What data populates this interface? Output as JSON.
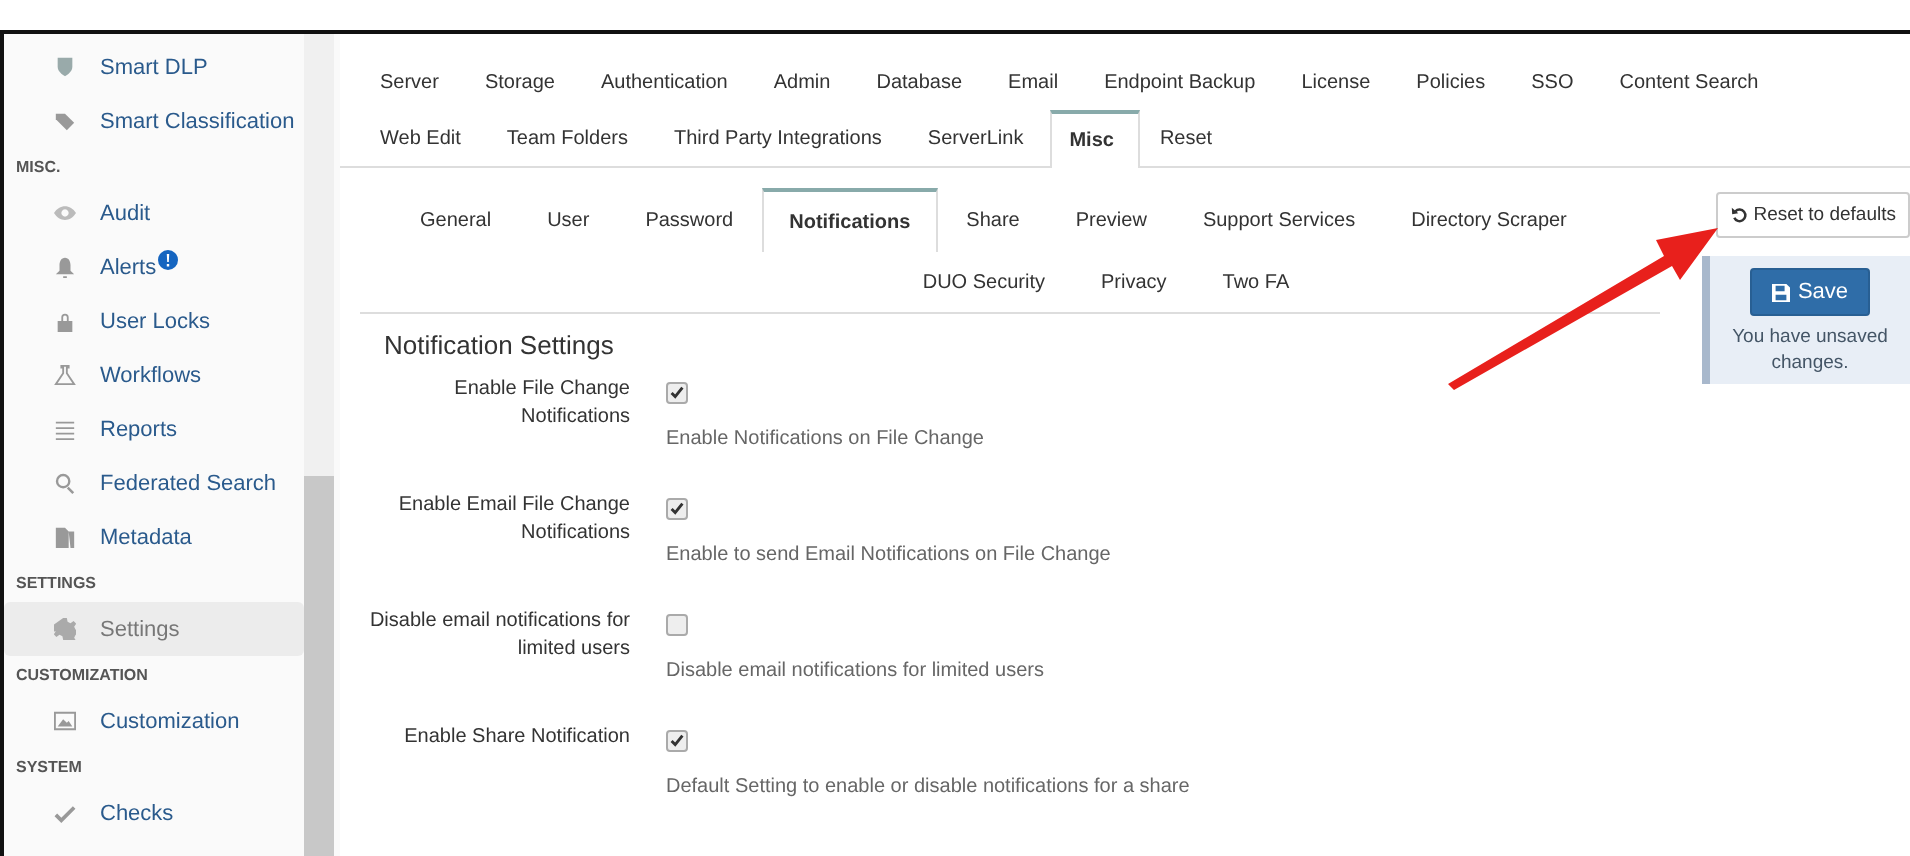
{
  "sidebar": {
    "items": [
      {
        "kind": "item",
        "label": "Smart DLP",
        "selected": false
      },
      {
        "kind": "item",
        "label": "Smart Classification",
        "selected": false
      },
      {
        "kind": "header",
        "label": "MISC."
      },
      {
        "kind": "item",
        "label": "Audit",
        "selected": false
      },
      {
        "kind": "item",
        "label": "Alerts",
        "badge": true,
        "selected": false
      },
      {
        "kind": "item",
        "label": "User Locks",
        "selected": false
      },
      {
        "kind": "item",
        "label": "Workflows",
        "selected": false
      },
      {
        "kind": "item",
        "label": "Reports",
        "selected": false
      },
      {
        "kind": "item",
        "label": "Federated Search",
        "selected": false
      },
      {
        "kind": "item",
        "label": "Metadata",
        "selected": false
      },
      {
        "kind": "header",
        "label": "SETTINGS"
      },
      {
        "kind": "item",
        "label": "Settings",
        "selected": true
      },
      {
        "kind": "header",
        "label": "CUSTOMIZATION"
      },
      {
        "kind": "item",
        "label": "Customization",
        "selected": false
      },
      {
        "kind": "header",
        "label": "SYSTEM"
      },
      {
        "kind": "item",
        "label": "Checks",
        "selected": false
      }
    ]
  },
  "tabs": [
    [
      {
        "label": "Server",
        "selected": false
      },
      {
        "label": "Storage",
        "selected": false
      },
      {
        "label": "Authentication",
        "selected": false
      },
      {
        "label": "Admin",
        "selected": false
      },
      {
        "label": "Database",
        "selected": false
      },
      {
        "label": "Email",
        "selected": false
      },
      {
        "label": "Endpoint Backup",
        "selected": false
      },
      {
        "label": "License",
        "selected": false
      },
      {
        "label": "Policies",
        "selected": false
      },
      {
        "label": "SSO",
        "selected": false
      },
      {
        "label": "Content Search",
        "selected": false
      }
    ],
    [
      {
        "label": "Web Edit",
        "selected": false
      },
      {
        "label": "Team Folders",
        "selected": false
      },
      {
        "label": "Third Party Integrations",
        "selected": false
      },
      {
        "label": "ServerLink",
        "selected": false
      },
      {
        "label": "Misc",
        "selected": true
      },
      {
        "label": "Reset",
        "selected": false
      }
    ]
  ],
  "subtabs": [
    [
      {
        "label": "General",
        "selected": false
      },
      {
        "label": "User",
        "selected": false
      },
      {
        "label": "Password",
        "selected": false
      },
      {
        "label": "Notifications",
        "selected": true
      },
      {
        "label": "Share",
        "selected": false
      },
      {
        "label": "Preview",
        "selected": false
      },
      {
        "label": "Support Services",
        "selected": false
      },
      {
        "label": "Directory Scraper",
        "selected": false
      }
    ],
    [
      {
        "label": "DUO Security",
        "selected": false
      },
      {
        "label": "Privacy",
        "selected": false
      },
      {
        "label": "Two FA",
        "selected": false
      }
    ]
  ],
  "section_title": "Notification Settings",
  "settings": [
    {
      "label": "Enable File Change Notifications",
      "checked": true,
      "help": "Enable Notifications on File Change"
    },
    {
      "label": "Enable Email File Change Notifications",
      "checked": true,
      "help": "Enable to send Email Notifications on File Change"
    },
    {
      "label": "Disable email notifications for limited users",
      "checked": false,
      "help": "Disable email notifications for limited users"
    },
    {
      "label": "Enable Share Notification",
      "checked": true,
      "help": "Default Setting to enable or disable notifications for a share"
    }
  ],
  "reset_button": "Reset to defaults",
  "save_button": "Save",
  "unsaved_note": "You have unsaved changes."
}
